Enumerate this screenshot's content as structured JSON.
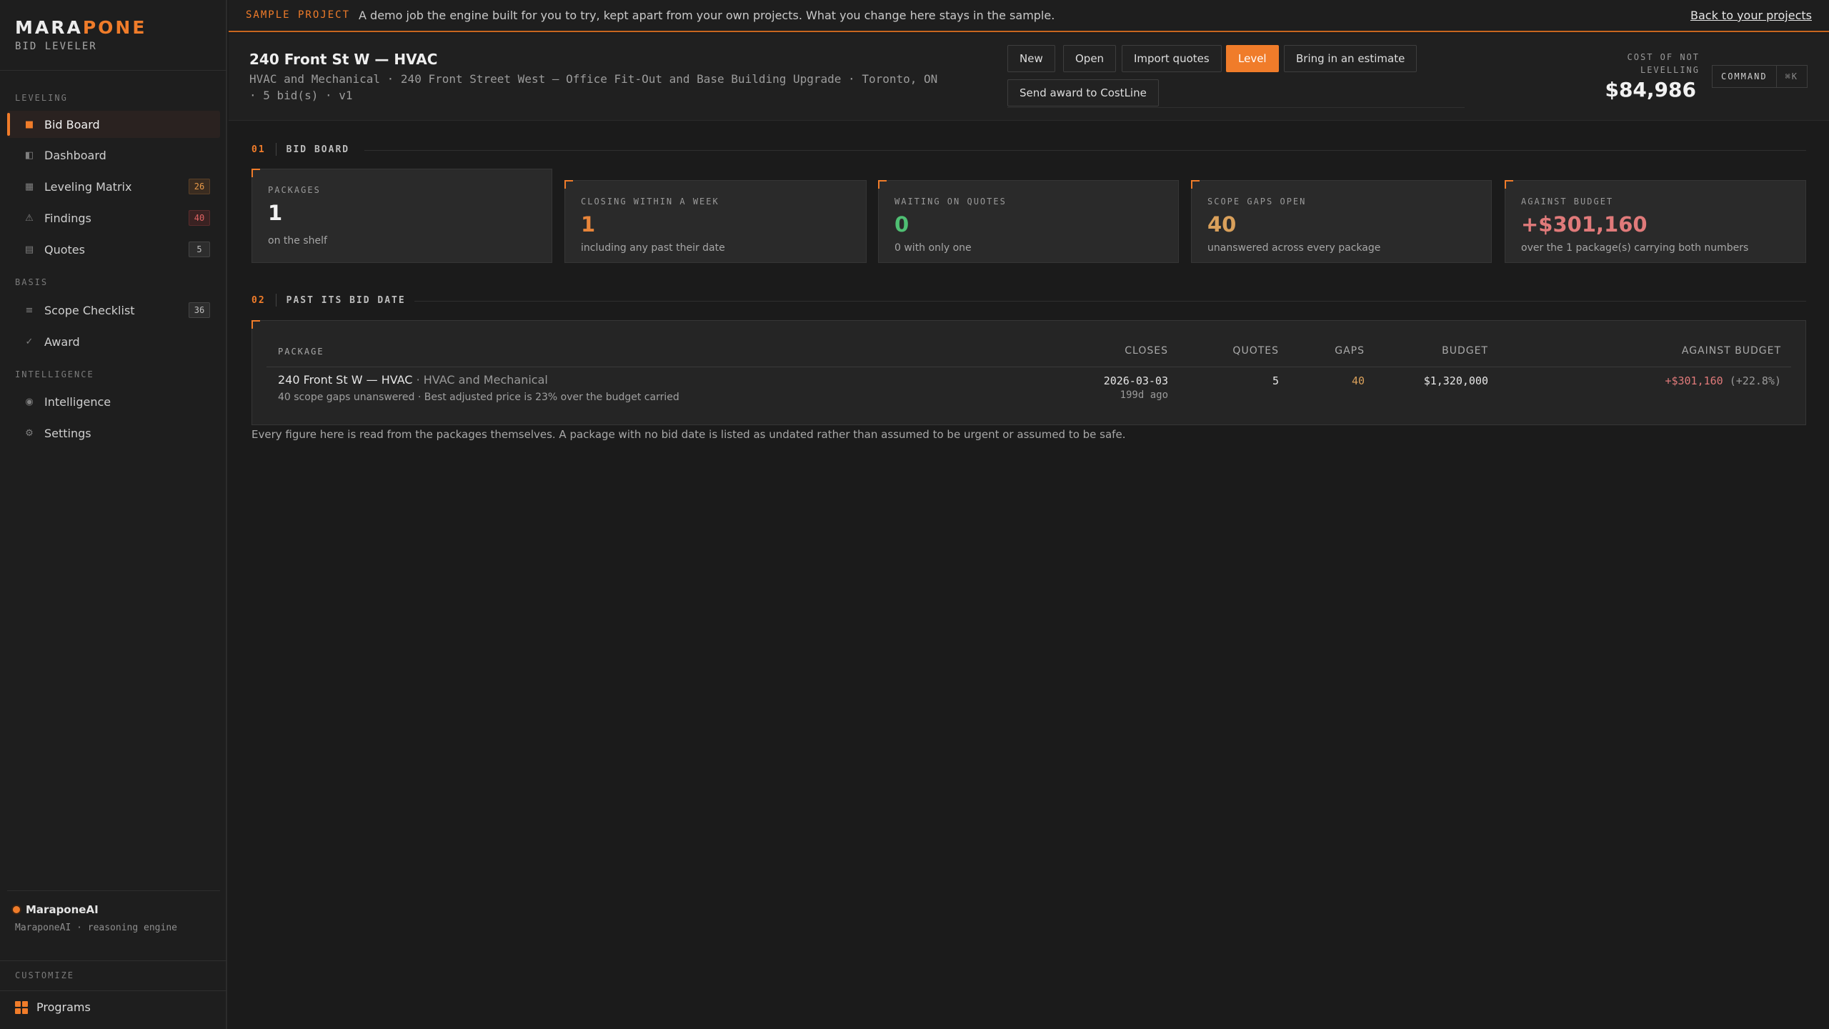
{
  "brand": {
    "name_a": "MARA",
    "name_b": "PONE",
    "subtitle": "BID LEVELER"
  },
  "sidebar": {
    "sections": [
      "LEVELING",
      "BASIS",
      "INTELLIGENCE"
    ],
    "items": [
      {
        "label": "Bid Board",
        "icon": "board-icon",
        "badge": ""
      },
      {
        "label": "Dashboard",
        "icon": "dashboard-icon",
        "badge": ""
      },
      {
        "label": "Leveling Matrix",
        "icon": "matrix-icon",
        "badge": "26"
      },
      {
        "label": "Findings",
        "icon": "warning-icon",
        "badge": "40"
      },
      {
        "label": "Quotes",
        "icon": "quotes-icon",
        "badge": "5"
      },
      {
        "label": "Scope Checklist",
        "icon": "checklist-icon",
        "badge": "36"
      },
      {
        "label": "Award",
        "icon": "check-icon",
        "badge": ""
      },
      {
        "label": "Intelligence",
        "icon": "intelligence-icon",
        "badge": ""
      },
      {
        "label": "Settings",
        "icon": "gear-icon",
        "badge": ""
      }
    ],
    "ai_name": "MaraponeAI",
    "ai_sub": "MaraponeAI · reasoning engine",
    "customize": "CUSTOMIZE",
    "programs": "Programs"
  },
  "banner": {
    "tag": "SAMPLE PROJECT",
    "text": "A demo job the engine built for you to try, kept apart from your own projects. What you change here stays in the sample.",
    "link": "Back to your projects"
  },
  "header": {
    "title": "240 Front St W — HVAC",
    "meta": "HVAC and Mechanical · 240 Front Street West — Office Fit-Out and Base Building Upgrade · Toronto, ON · 5 bid(s) · v1",
    "buttons": {
      "new": "New",
      "open": "Open",
      "import": "Import quotes",
      "level": "Level",
      "estimate": "Bring in an estimate",
      "award": "Send award to CostLine"
    },
    "cost_label_1": "COST OF NOT",
    "cost_label_2": "LEVELLING",
    "cost_value": "$84,986",
    "command_label": "COMMAND",
    "command_key": "⌘K"
  },
  "bid_board": {
    "num": "01",
    "title": "BID BOARD",
    "cards": [
      {
        "label": "PACKAGES",
        "value": "1",
        "sub": "on the shelf",
        "color": "#f2f2f2"
      },
      {
        "label": "CLOSING WITHIN A WEEK",
        "value": "1",
        "sub": "including any past their date",
        "color": "#e8853a"
      },
      {
        "label": "WAITING ON QUOTES",
        "value": "0",
        "sub": "0 with only one",
        "color": "#4fbf73"
      },
      {
        "label": "SCOPE GAPS OPEN",
        "value": "40",
        "sub": "unanswered across every package",
        "color": "#d9a05b"
      },
      {
        "label": "AGAINST BUDGET",
        "value": "+$301,160",
        "sub": "over the 1 package(s) carrying both numbers",
        "color": "#e07a7a"
      }
    ]
  },
  "past_date": {
    "num": "02",
    "title": "PAST ITS BID DATE",
    "headers": {
      "package": "PACKAGE",
      "closes": "CLOSES",
      "quotes": "QUOTES",
      "gaps": "GAPS",
      "budget": "BUDGET",
      "against": "AGAINST BUDGET"
    },
    "row": {
      "name": "240 Front St W — HVAC",
      "trade": " · HVAC and Mechanical",
      "note": "40 scope gaps unanswered · Best adjusted price is 23% over the budget carried",
      "closes": "2026-03-03",
      "closes_ago": "199d ago",
      "quotes": "5",
      "gaps": "40",
      "budget": "$1,320,000",
      "against": "+$301,160",
      "against_pct": " (+22.8%)"
    },
    "footnote": "Every figure here is read from the packages themselves. A package with no bid date is listed as undated rather than assumed to be urgent or assumed to be safe."
  }
}
